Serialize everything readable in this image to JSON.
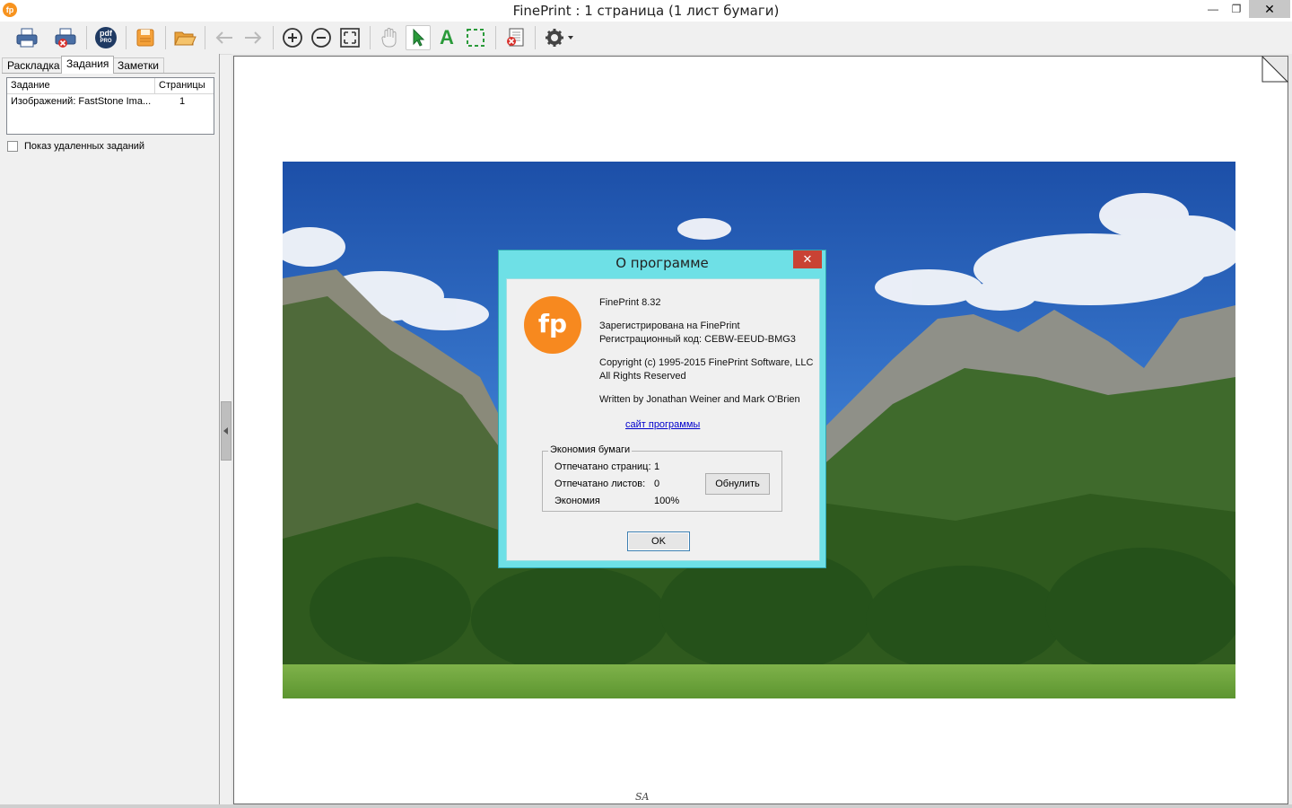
{
  "window": {
    "title": "FinePrint : 1 страница (1 лист бумаги)",
    "app_icon_text": "fp"
  },
  "toolbar": {
    "buttons": [
      "print-icon",
      "print-delete-icon",
      "pdf-pro-icon",
      "save-icon",
      "open-folder-icon",
      "back-arrow-icon",
      "forward-arrow-icon",
      "zoom-in-icon",
      "zoom-out-icon",
      "fit-page-icon",
      "hand-icon",
      "select-arrow-icon",
      "text-tool-icon",
      "marquee-select-icon",
      "delete-page-icon",
      "settings-icon"
    ],
    "pdf_label": "pdf",
    "pdf_sub": "PRO"
  },
  "left_pane": {
    "tabs": [
      "Раскладка",
      "Задания",
      "Заметки"
    ],
    "selected_tab": "Задания",
    "columns": [
      "Задание",
      "Страницы"
    ],
    "jobs": [
      {
        "name": "Изображений: FastStone Ima...",
        "pages": "1"
      }
    ],
    "show_deleted_label": "Показ удаленных заданий",
    "show_deleted_checked": false
  },
  "document": {
    "footer_mark": "SA"
  },
  "about_dialog": {
    "title": "О программе",
    "close_glyph": "✕",
    "logo_text": "fp",
    "version": "FinePrint 8.32",
    "registered_to": "Зарегистрирована на FinePrint",
    "reg_code": "Регистрационный код: CEBW-EEUD-BMG3",
    "copyright": "Copyright (c) 1995-2015 FinePrint Software, LLC",
    "rights": "All Rights Reserved",
    "authors": "Written by Jonathan Weiner and Mark O'Brien",
    "site_link": "сайт программы",
    "savings": {
      "group_label": "Экономия бумаги",
      "pages_printed_label": "Отпечатано страниц:",
      "pages_printed_value": "1",
      "sheets_printed_label": "Отпечатано листов:",
      "sheets_printed_value": "0",
      "economy_label": "Экономия",
      "economy_value": "100%",
      "reset_button": "Обнулить"
    },
    "ok_button": "OK"
  },
  "colors": {
    "dialog_frame": "#6ee0e6",
    "dialog_close": "#c94234",
    "brand_orange": "#f7891f",
    "link": "#0000cc"
  }
}
